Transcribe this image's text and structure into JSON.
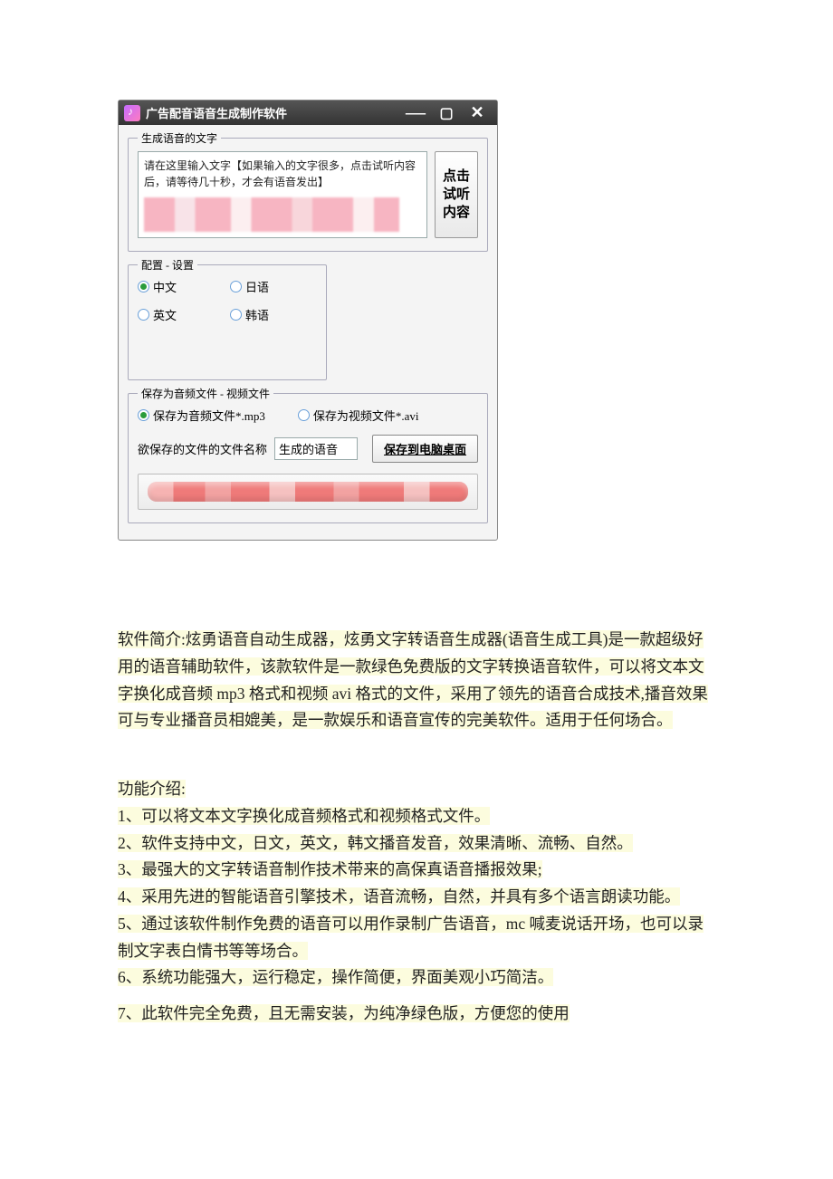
{
  "window": {
    "title": "广告配音语音生成制作软件"
  },
  "generate": {
    "legend": "生成语音的文字",
    "placeholder": "请在这里输入文字【如果输入的文字很多，点击试听内容后，请等待几十秒，才会有语音发出】",
    "preview_btn": "点击试听内容"
  },
  "config": {
    "legend": "配置 - 设置",
    "options": {
      "zh": "中文",
      "en": "英文",
      "jp": "日语",
      "kr": "韩语"
    },
    "selected": "zh"
  },
  "save": {
    "legend": "保存为音频文件 - 视频文件",
    "option_mp3": "保存为音频文件*.mp3",
    "option_avi": "保存为视频文件*.avi",
    "filename_label": "欲保存的文件的文件名称",
    "filename_value": "生成的语音",
    "save_btn": "保存到电脑桌面"
  },
  "article": {
    "intro": "软件简介:炫勇语音自动生成器，炫勇文字转语音生成器(语音生成工具)是一款超级好用的语音辅助软件，该款软件是一款绿色免费版的文字转换语音软件，可以将文本文字换化成音频 mp3 格式和视频 avi 格式的文件，采用了领先的语音合成技术,播音效果可与专业播音员相媲美，是一款娱乐和语音宣传的完美软件。适用于任何场合。",
    "features_title": "功能介绍:",
    "features": {
      "f1": "1、可以将文本文字换化成音频格式和视频格式文件。",
      "f2": "2、软件支持中文，日文，英文，韩文播音发音，效果清晰、流畅、自然。",
      "f3": "3、最强大的文字转语音制作技术带来的高保真语音播报效果;",
      "f4": "4、采用先进的智能语音引擎技术，语音流畅，自然，并具有多个语言朗读功能。",
      "f5": "5、通过该软件制作免费的语音可以用作录制广告语音，mc 喊麦说话开场，也可以录制文字表白情书等等场合。",
      "f6": "6、系统功能强大，运行稳定，操作简便，界面美观小巧简洁。",
      "f7": "7、此软件完全免费，且无需安装，为纯净绿色版，方便您的使用"
    }
  }
}
